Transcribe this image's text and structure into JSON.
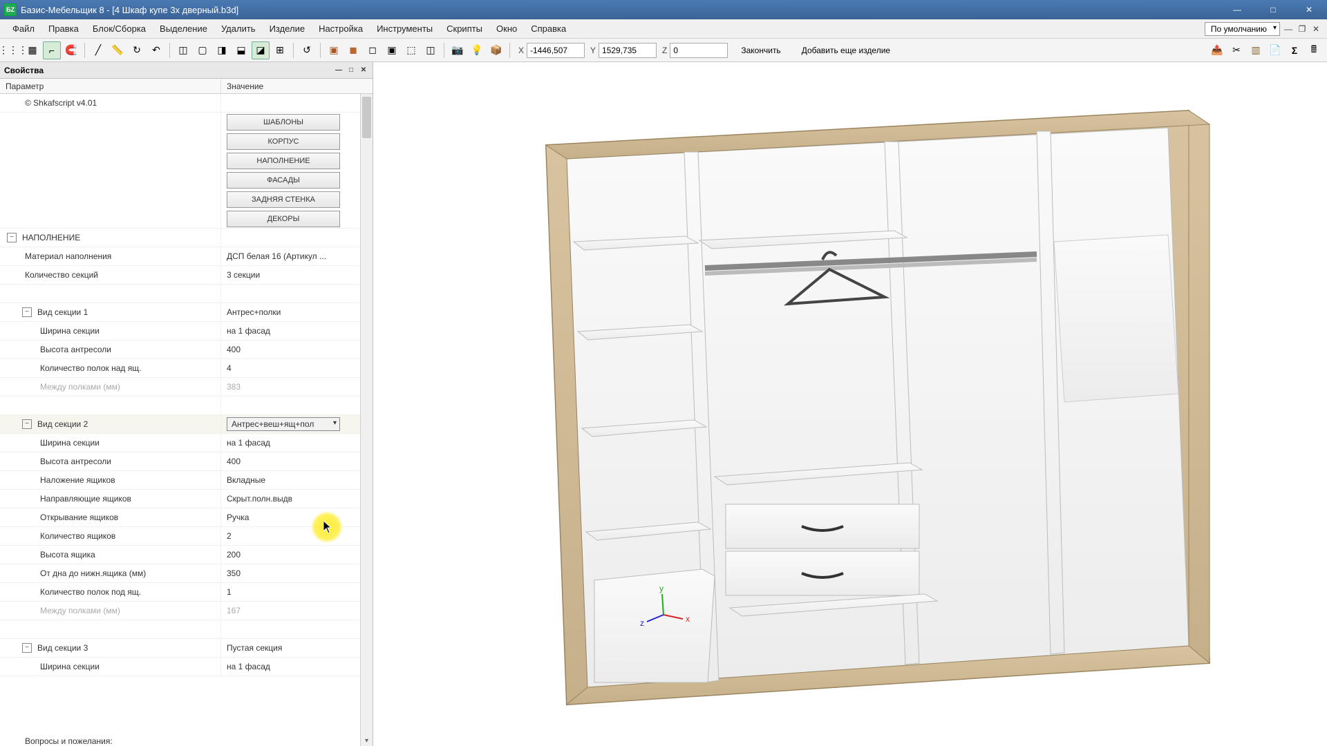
{
  "titlebar": {
    "app_icon_text": "БZ",
    "title": "Базис-Мебельщик 8 - [4 Шкаф купе 3х дверный.b3d]"
  },
  "menubar": {
    "items": [
      "Файл",
      "Правка",
      "Блок/Сборка",
      "Выделение",
      "Удалить",
      "Изделие",
      "Настройка",
      "Инструменты",
      "Скрипты",
      "Окно",
      "Справка"
    ],
    "right_combo": "По умолчанию"
  },
  "toolbar": {
    "coords": {
      "x_label": "X",
      "x": "-1446,507",
      "y_label": "Y",
      "y": "1529,735",
      "z_label": "Z",
      "z": "0"
    },
    "finish": "Закончить",
    "add_more": "Добавить еще изделие"
  },
  "props": {
    "header": "Свойства",
    "cols": {
      "param": "Параметр",
      "value": "Значение"
    },
    "script_label": "© Shkafscript v4.01",
    "buttons": [
      "ШАБЛОНЫ",
      "КОРПУС",
      "НАПОЛНЕНИЕ",
      "ФАСАДЫ",
      "ЗАДНЯЯ СТЕНКА",
      "ДЕКОРЫ"
    ],
    "napolnenie": {
      "title": "НАПОЛНЕНИЕ",
      "rows": [
        {
          "label": "Материал наполнения",
          "value": "ДСП белая 16 (Артикул ..."
        },
        {
          "label": "Количество секций",
          "value": "3 секции"
        }
      ]
    },
    "section1": {
      "title": "Вид секции 1",
      "type": "Антрес+полки",
      "rows": [
        {
          "label": "Ширина секции",
          "value": "на 1 фасад"
        },
        {
          "label": "Высота антресоли",
          "value": "400"
        },
        {
          "label": "Количество полок над ящ.",
          "value": "4"
        },
        {
          "label": "Между полками (мм)",
          "value": "383",
          "disabled": true
        }
      ]
    },
    "section2": {
      "title": "Вид секции 2",
      "type": "Антрес+веш+ящ+пол",
      "rows": [
        {
          "label": "Ширина секции",
          "value": "на 1 фасад"
        },
        {
          "label": "Высота антресоли",
          "value": "400"
        },
        {
          "label": "Наложение ящиков",
          "value": "Вкладные"
        },
        {
          "label": "Направляющие ящиков",
          "value": "Скрыт.полн.выдв"
        },
        {
          "label": "Открывание ящиков",
          "value": "Ручка"
        },
        {
          "label": "Количество ящиков",
          "value": "2"
        },
        {
          "label": "Высота ящика",
          "value": "200"
        },
        {
          "label": "От дна до нижн.ящика (мм)",
          "value": "350"
        },
        {
          "label": "Количество полок под ящ.",
          "value": "1"
        },
        {
          "label": "Между полками (мм)",
          "value": "167",
          "disabled": true
        }
      ]
    },
    "section3": {
      "title": "Вид секции 3",
      "type": "Пустая секция",
      "rows": [
        {
          "label": "Ширина секции",
          "value": "на 1 фасад"
        }
      ]
    },
    "bottom": "Вопросы и пожелания:"
  }
}
